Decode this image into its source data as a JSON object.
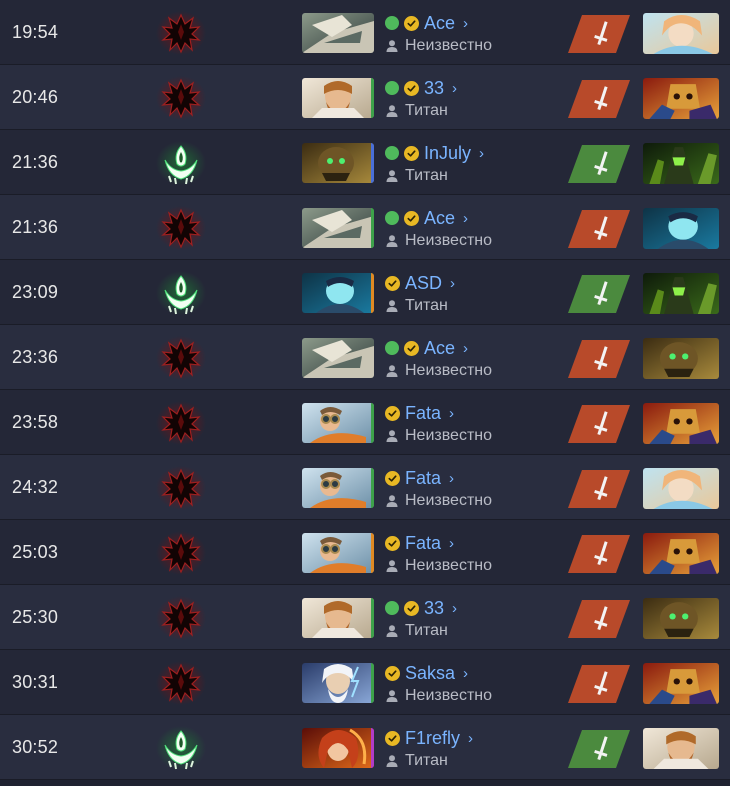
{
  "colors": {
    "bg_row_odd": "#242737",
    "bg_row_even": "#292d3f",
    "player_link": "#7ab4ff",
    "online": "#4fba5c",
    "verified": "#e8b824",
    "result_loss": "#b84a2a",
    "result_win": "#4b8a3e",
    "dire": "#b01a1a",
    "radiant": "#3fbf5a"
  },
  "rows": [
    {
      "time": "19:54",
      "faction": "dire",
      "hero": "spirit-breaker",
      "stripe": "none",
      "online": true,
      "player": "Ace",
      "rank": "Неизвестно",
      "result": "loss",
      "enemy": "crystal-maiden"
    },
    {
      "time": "20:46",
      "faction": "dire",
      "hero": "keeper-bearded",
      "stripe": "#3da24a",
      "online": true,
      "player": "33",
      "rank": "Титан",
      "result": "loss",
      "enemy": "juggernaut"
    },
    {
      "time": "21:36",
      "faction": "radiant",
      "hero": "earth-hero",
      "stripe": "#4a6fd8",
      "online": true,
      "player": "InJuly",
      "rank": "Титан",
      "result": "win",
      "enemy": "green-dark"
    },
    {
      "time": "21:36",
      "faction": "dire",
      "hero": "spirit-breaker",
      "stripe": "#3da24a",
      "online": true,
      "player": "Ace",
      "rank": "Неизвестно",
      "result": "loss",
      "enemy": "cyan-hero"
    },
    {
      "time": "23:09",
      "faction": "radiant",
      "hero": "cyan-hero",
      "stripe": "#e08a23",
      "online": false,
      "player": "ASD",
      "rank": "Титан",
      "result": "win",
      "enemy": "green-dark"
    },
    {
      "time": "23:36",
      "faction": "dire",
      "hero": "spirit-breaker",
      "stripe": "none",
      "online": true,
      "player": "Ace",
      "rank": "Неизвестно",
      "result": "loss",
      "enemy": "earth-hero"
    },
    {
      "time": "23:58",
      "faction": "dire",
      "hero": "pilot",
      "stripe": "#3da24a",
      "online": false,
      "player": "Fata",
      "rank": "Неизвестно",
      "result": "loss",
      "enemy": "juggernaut"
    },
    {
      "time": "24:32",
      "faction": "dire",
      "hero": "pilot",
      "stripe": "#3da24a",
      "online": false,
      "player": "Fata",
      "rank": "Неизвестно",
      "result": "loss",
      "enemy": "crystal-maiden"
    },
    {
      "time": "25:03",
      "faction": "dire",
      "hero": "pilot",
      "stripe": "#e08a23",
      "online": false,
      "player": "Fata",
      "rank": "Неизвестно",
      "result": "loss",
      "enemy": "juggernaut"
    },
    {
      "time": "25:30",
      "faction": "dire",
      "hero": "keeper-bearded",
      "stripe": "#3da24a",
      "online": true,
      "player": "33",
      "rank": "Титан",
      "result": "loss",
      "enemy": "earth-hero"
    },
    {
      "time": "30:31",
      "faction": "dire",
      "hero": "zeus",
      "stripe": "#3da24a",
      "online": false,
      "player": "Saksa",
      "rank": "Неизвестно",
      "result": "loss",
      "enemy": "juggernaut"
    },
    {
      "time": "30:52",
      "faction": "radiant",
      "hero": "lina",
      "stripe": "#b23cc7",
      "online": false,
      "player": "F1refly",
      "rank": "Титан",
      "result": "win",
      "enemy": "keeper-bearded"
    }
  ]
}
